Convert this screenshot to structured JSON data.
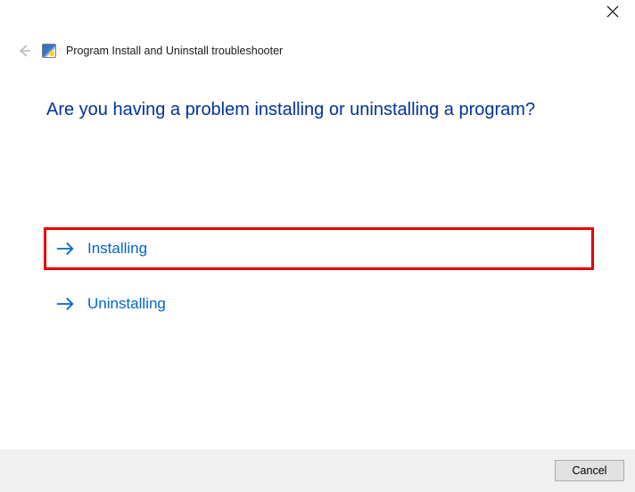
{
  "header": {
    "title": "Program Install and Uninstall troubleshooter"
  },
  "main": {
    "question": "Are you having a problem installing or uninstalling a program?",
    "options": [
      {
        "label": "Installing"
      },
      {
        "label": "Uninstalling"
      }
    ]
  },
  "footer": {
    "cancel_label": "Cancel"
  },
  "colors": {
    "link": "#0066cc",
    "heading": "#003399",
    "highlight_border": "#e70000",
    "footer_bg": "#f0f0f0"
  }
}
